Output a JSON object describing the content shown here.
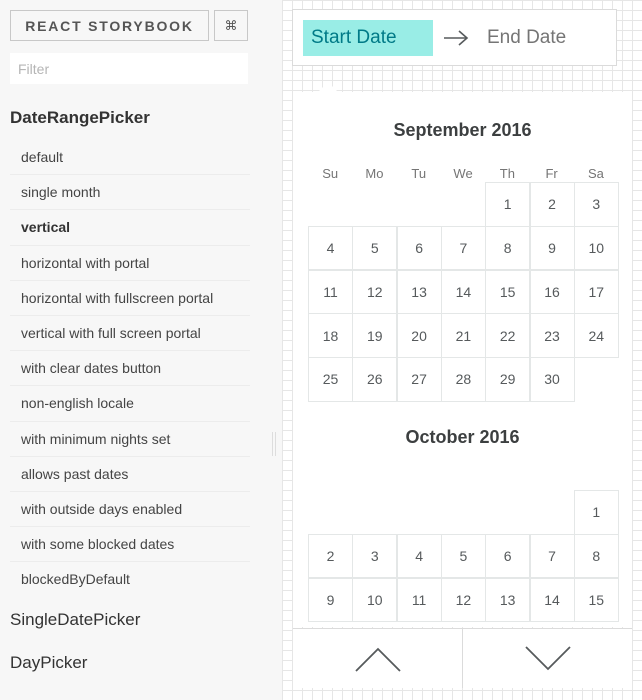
{
  "header": {
    "title": "REACT STORYBOOK",
    "shortcut_icon": "⌘"
  },
  "filter": {
    "placeholder": "Filter",
    "value": ""
  },
  "kinds": [
    {
      "title": "DateRangePicker",
      "stories": [
        "default",
        "single month",
        "vertical",
        "horizontal with portal",
        "horizontal with fullscreen portal",
        "vertical with full screen portal",
        "with clear dates button",
        "non-english locale",
        "with minimum nights set",
        "allows past dates",
        "with outside days enabled",
        "with some blocked dates",
        "blockedByDefault"
      ],
      "active_story": "vertical"
    },
    {
      "title": "SingleDatePicker"
    },
    {
      "title": "DayPicker"
    }
  ],
  "date_range": {
    "start_placeholder": "Start Date",
    "end_placeholder": "End Date",
    "arrow_icon": "arrow-right-icon"
  },
  "calendar": {
    "weekdays": [
      "Su",
      "Mo",
      "Tu",
      "We",
      "Th",
      "Fr",
      "Sa"
    ],
    "months": [
      {
        "title": "September 2016",
        "weeks": [
          [
            "",
            "",
            "",
            "",
            "1",
            "2",
            "3"
          ],
          [
            "4",
            "5",
            "6",
            "7",
            "8",
            "9",
            "10"
          ],
          [
            "11",
            "12",
            "13",
            "14",
            "15",
            "16",
            "17"
          ],
          [
            "18",
            "19",
            "20",
            "21",
            "22",
            "23",
            "24"
          ],
          [
            "25",
            "26",
            "27",
            "28",
            "29",
            "30",
            ""
          ]
        ]
      },
      {
        "title": "October 2016",
        "weeks": [
          [
            "",
            "",
            "",
            "",
            "",
            "",
            "1"
          ],
          [
            "2",
            "3",
            "4",
            "5",
            "6",
            "7",
            "8"
          ],
          [
            "9",
            "10",
            "11",
            "12",
            "13",
            "14",
            "15"
          ]
        ]
      }
    ],
    "nav": {
      "prev_icon": "chevron-up-icon",
      "next_icon": "chevron-down-icon"
    }
  },
  "colors": {
    "selected_input_bg": "#99ede6",
    "selected_input_text": "#007a87",
    "day_border": "#e4e7e7"
  }
}
